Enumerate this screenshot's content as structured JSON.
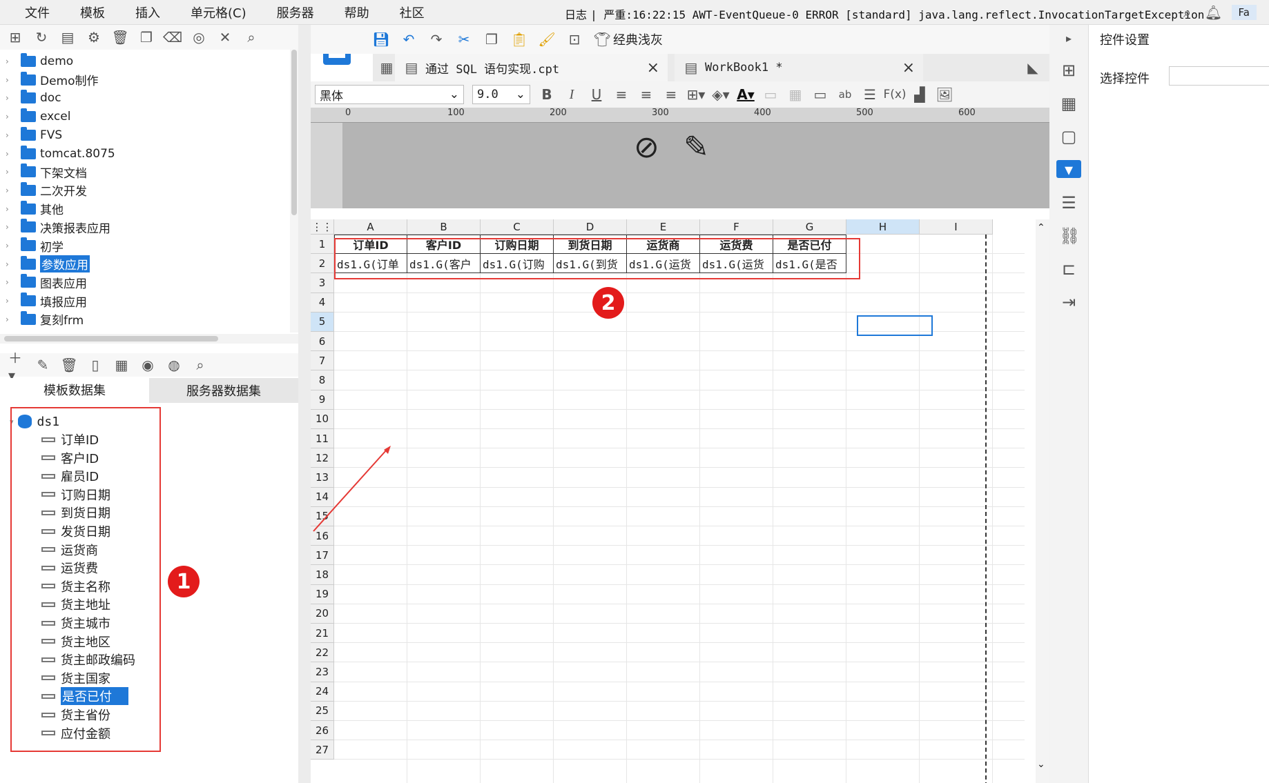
{
  "menu": [
    "文件",
    "模板",
    "插入",
    "单元格(C)",
    "服务器",
    "帮助",
    "社区"
  ],
  "log": {
    "label": "日志",
    "text": "| 严重:16:22:15 AWT-EventQueue-0 ERROR [standard] java.lang.reflect.InvocationTargetException"
  },
  "topright_pill": "Fa",
  "tree_items": [
    "demo",
    "Demo制作",
    "doc",
    "excel",
    "FVS",
    "tomcat.8075",
    "下架文档",
    "二次开发",
    "其他",
    "决策报表应用",
    "初学",
    "参数应用",
    "图表应用",
    "填报应用",
    "复刻frm"
  ],
  "tree_selected": "参数应用",
  "ds_tabs": {
    "template": "模板数据集",
    "server": "服务器数据集"
  },
  "dataset": {
    "name": "ds1",
    "fields": [
      "订单ID",
      "客户ID",
      "雇员ID",
      "订购日期",
      "到货日期",
      "发货日期",
      "运货商",
      "运货费",
      "货主名称",
      "货主地址",
      "货主城市",
      "货主地区",
      "货主邮政编码",
      "货主国家",
      "是否已付",
      "货主省份",
      "应付金额"
    ],
    "selected": "是否已付"
  },
  "toolbar": {
    "theme_label": "经典浅灰"
  },
  "file_tabs": [
    {
      "label": "通过 SQL 语句实现.cpt"
    },
    {
      "label": "WorkBook1 *"
    }
  ],
  "format": {
    "font": "黑体",
    "size": "9.0"
  },
  "ruler_ticks": [
    "0",
    "100",
    "200",
    "300",
    "400",
    "500",
    "600"
  ],
  "sheet": {
    "columns": [
      "A",
      "B",
      "C",
      "D",
      "E",
      "F",
      "G",
      "H",
      "I"
    ],
    "rows": [
      "1",
      "2",
      "3",
      "4",
      "5",
      "6",
      "7",
      "8",
      "9",
      "10",
      "11",
      "12",
      "13",
      "14",
      "15",
      "16",
      "17",
      "18",
      "19",
      "20",
      "21",
      "22",
      "23",
      "24",
      "25",
      "26",
      "27"
    ],
    "header_row": [
      "订单ID",
      "客户ID",
      "订购日期",
      "到货日期",
      "运货商",
      "运货费",
      "是否已付"
    ],
    "data_row": [
      "ds1.G(订单",
      "ds1.G(客户",
      "ds1.G(订购",
      "ds1.G(到货",
      "ds1.G(运货",
      "ds1.G(运货",
      "ds1.G(是否"
    ],
    "selected_cell": "H5"
  },
  "badges": [
    "1",
    "2"
  ],
  "right_panel": {
    "title": "控件设置",
    "label": "选择控件"
  },
  "colors": {
    "accent": "#1e78d8",
    "annotation": "#e53935",
    "badge": "#e31b1b"
  }
}
